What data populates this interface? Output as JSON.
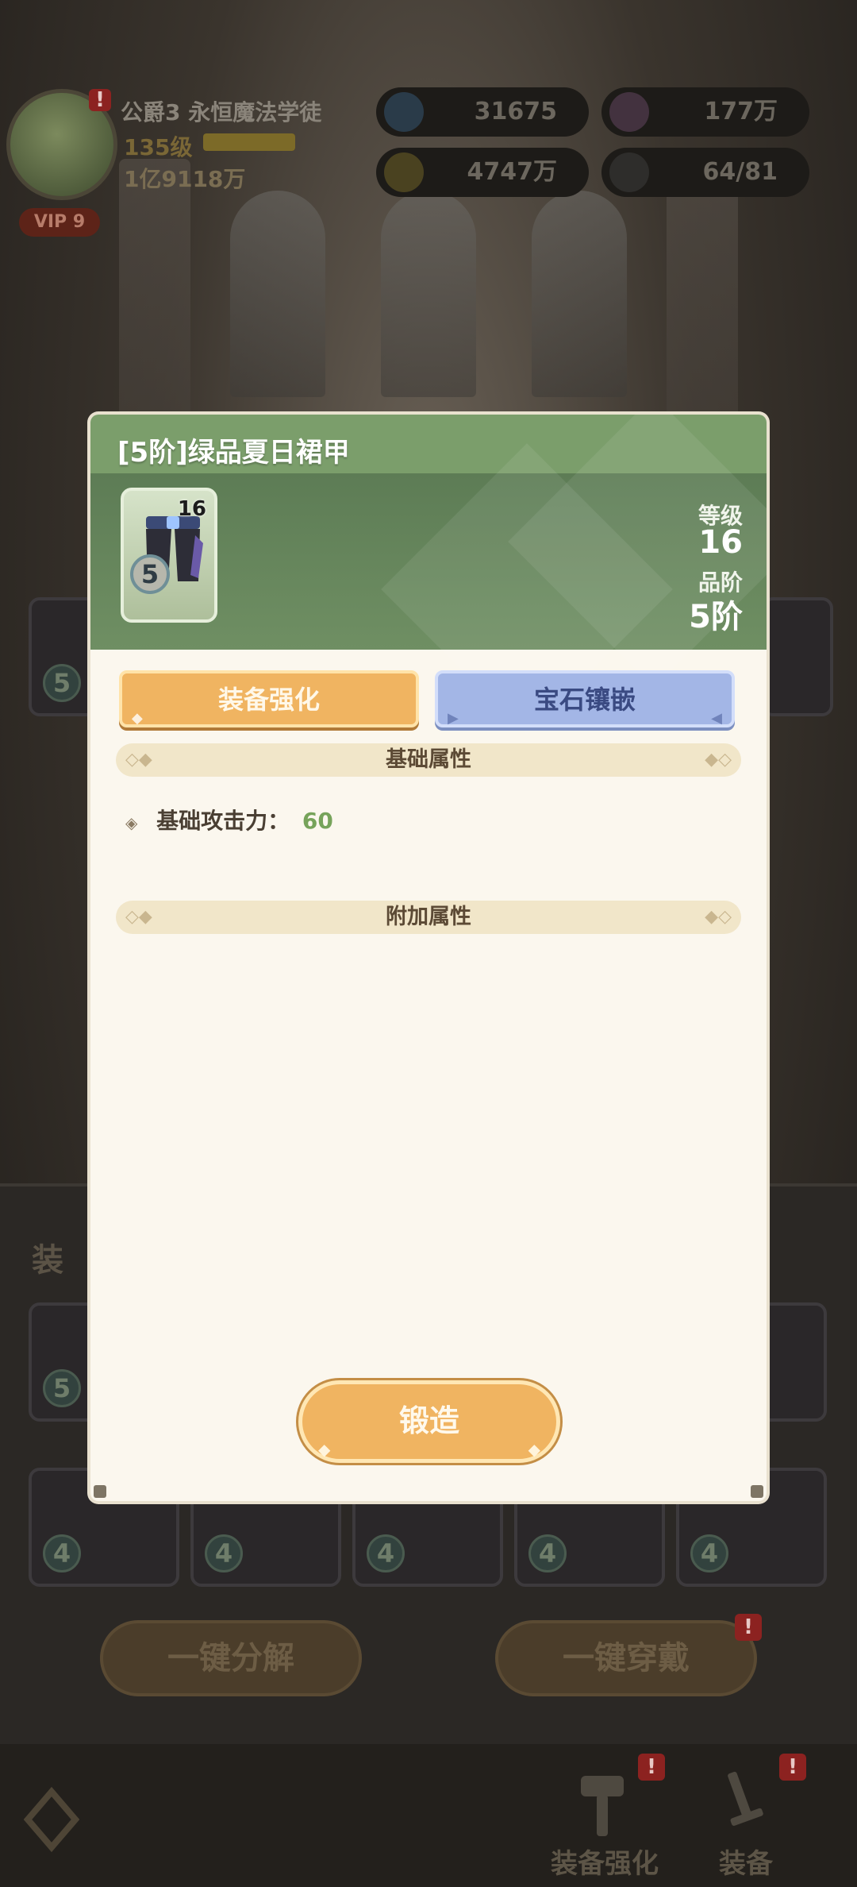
{
  "hud": {
    "player_title": "公爵3 永恒魔法学徒",
    "level": "135级",
    "level_progress": 1.0,
    "power": "1亿9118万",
    "vip": "VIP 9",
    "resources": {
      "stars": "31675",
      "gems": "177万",
      "gold": "4747万",
      "members": "64/81"
    }
  },
  "modal": {
    "title": "[5阶]绿品夏日裙甲",
    "item": {
      "icon": "pants-armor-icon",
      "level": "16",
      "tier": "5"
    },
    "stats": {
      "level_label": "等级",
      "level_value": "16",
      "tier_label": "品阶",
      "tier_value": "5阶"
    },
    "tabs": {
      "enhance": "装备强化",
      "gem": "宝石镶嵌"
    },
    "sections": {
      "base": "基础属性",
      "extra": "附加属性"
    },
    "base_attrs": [
      {
        "label": "基础攻击力：",
        "value": "60"
      }
    ],
    "forge_button": "锻造"
  },
  "background": {
    "panel_title": "装",
    "action_buttons": {
      "decompose": "一键分解",
      "equip_all": "一键穿戴"
    },
    "slot_tiers": [
      "5",
      "4",
      "4",
      "4",
      "4",
      "4"
    ],
    "nav": {
      "enhance": "装备强化",
      "equip": "装备"
    },
    "badge": "!"
  },
  "colors": {
    "header_green": "#7b9e6b",
    "enhance_orange": "#f0b461",
    "gem_blue": "#a3b6e6",
    "value_green": "#76a35a"
  }
}
